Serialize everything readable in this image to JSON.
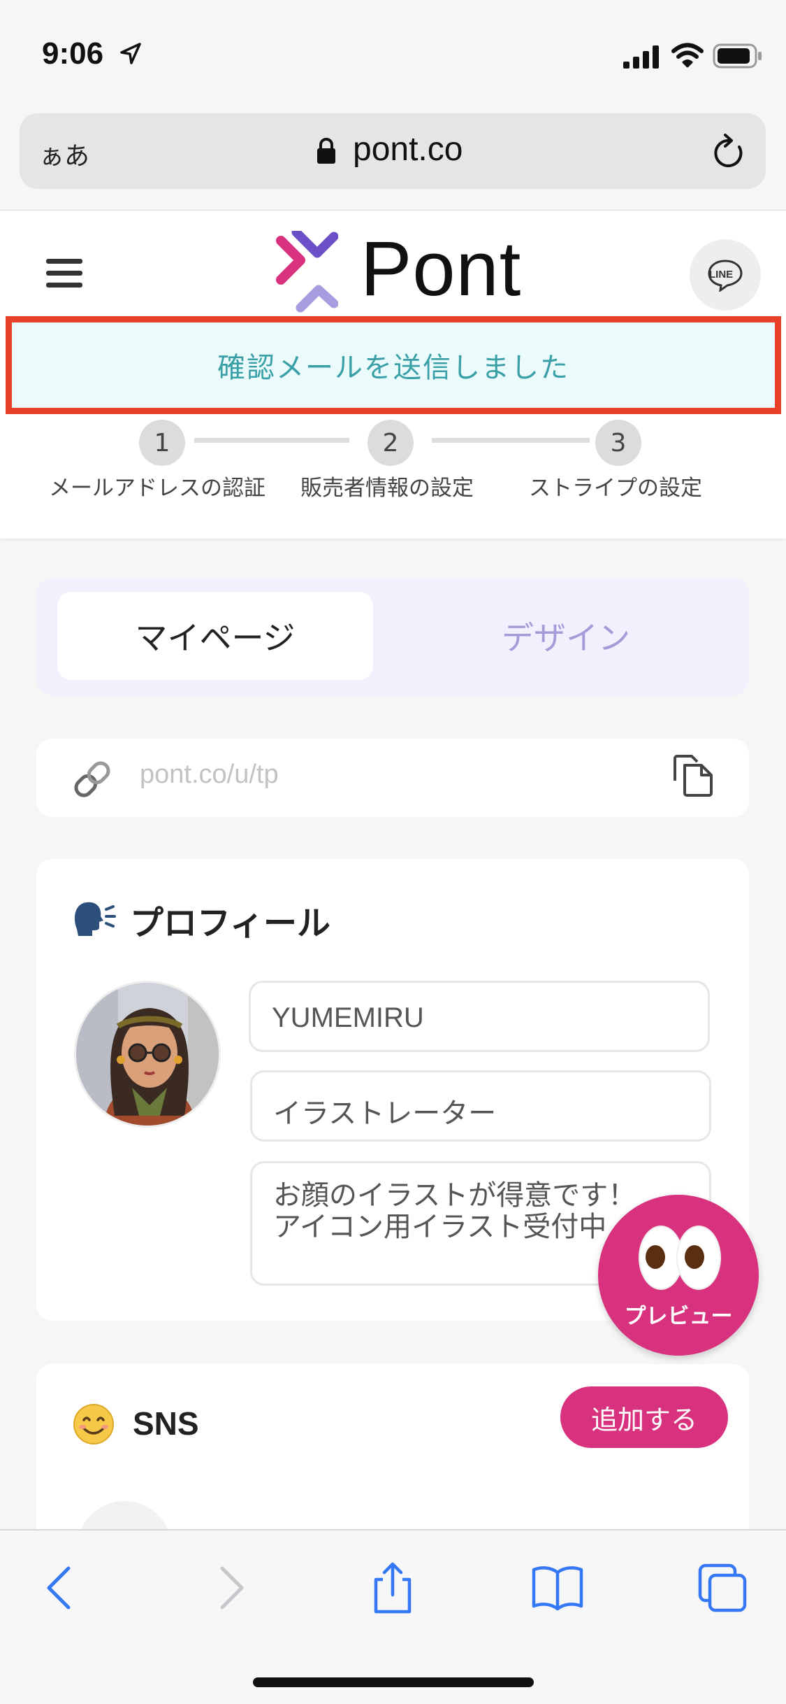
{
  "status_bar": {
    "time": "9:06"
  },
  "browser": {
    "text_size_label": "ぁあ",
    "url": "pont.co"
  },
  "header": {
    "logo_text": "Pont",
    "line_label": "LINE"
  },
  "notice": {
    "message": "確認メールを送信しました"
  },
  "steps": [
    {
      "number": "1",
      "label": "メールアドレスの認証"
    },
    {
      "number": "2",
      "label": "販売者情報の設定"
    },
    {
      "number": "3",
      "label": "ストライプの設定"
    }
  ],
  "tabs": {
    "active": "マイページ",
    "inactive": "デザイン"
  },
  "page_url": {
    "value": "pont.co/u/tp"
  },
  "profile": {
    "title": "プロフィール",
    "name": "YUMEMIRU",
    "role": "イラストレーター",
    "bio_line1": "お顔のイラストが得意です！",
    "bio_line2": "アイコン用イラスト受付中"
  },
  "preview": {
    "label": "プレビュー"
  },
  "sns": {
    "title": "SNS",
    "add_label": "追加する"
  },
  "colors": {
    "accent": "#d8317d",
    "notice_border": "#e8402a",
    "notice_bg": "#ebfafa",
    "notice_text": "#3aa0a8",
    "tab_inactive": "#a89ad8",
    "ios_blue": "#3478f6"
  }
}
